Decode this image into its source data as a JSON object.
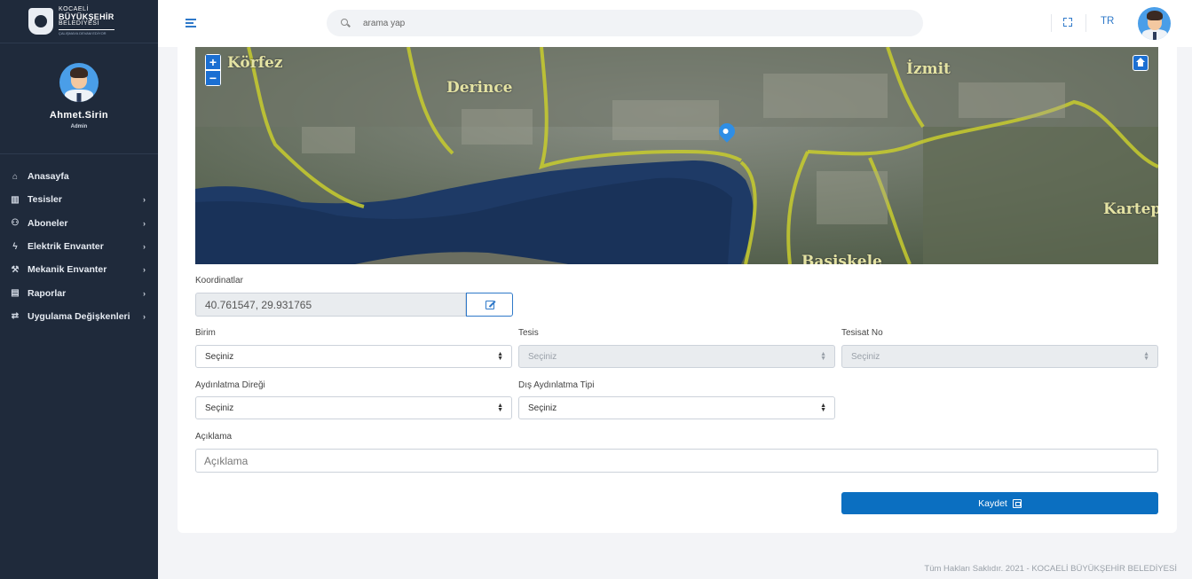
{
  "sidebar": {
    "logo": {
      "line1": "KOCAELİ",
      "line2": "BÜYÜKŞEHİR",
      "line3": "BELEDİYESİ",
      "line4": "ÇALIŞMAYA DEVAM EDİYOR"
    },
    "user": {
      "name": "Ahmet.Sirin",
      "role": "Admin"
    },
    "items": [
      {
        "label": "Anasayfa",
        "icon": "home-icon",
        "has_submenu": false
      },
      {
        "label": "Tesisler",
        "icon": "building-icon",
        "has_submenu": true
      },
      {
        "label": "Aboneler",
        "icon": "users-icon",
        "has_submenu": true
      },
      {
        "label": "Elektrik Envanter",
        "icon": "lightning-icon",
        "has_submenu": true
      },
      {
        "label": "Mekanik Envanter",
        "icon": "wrench-icon",
        "has_submenu": true
      },
      {
        "label": "Raporlar",
        "icon": "report-icon",
        "has_submenu": true
      },
      {
        "label": "Uygulama Değişkenleri",
        "icon": "sync-icon",
        "has_submenu": true
      }
    ]
  },
  "header": {
    "search_placeholder": "arama yap",
    "language": "TR"
  },
  "map": {
    "labels": [
      "Körfez",
      "Derince",
      "İzmit",
      "Kartepe",
      "Başiskele"
    ],
    "zoom_in": "+",
    "zoom_out": "−"
  },
  "form": {
    "coordinates_label": "Koordinatlar",
    "coordinates_value": "40.761547, 29.931765",
    "birim": {
      "label": "Birim",
      "value": "Seçiniz"
    },
    "tesis": {
      "label": "Tesis",
      "value": "Seçiniz"
    },
    "tesisat_no": {
      "label": "Tesisat No",
      "value": "Seçiniz"
    },
    "aydinlatma_diregi": {
      "label": "Aydınlatma Direği",
      "value": "Seçiniz"
    },
    "dis_aydinlatma_tipi": {
      "label": "Dış Aydınlatma Tipi",
      "value": "Seçiniz"
    },
    "aciklama": {
      "label": "Açıklama",
      "placeholder": "Açıklama"
    },
    "save_label": "Kaydet"
  },
  "footer": {
    "text": "Tüm Hakları Saklıdır. 2021 - KOCAELİ BÜYÜKŞEHİR BELEDİYESİ"
  },
  "colors": {
    "sidebar_bg": "#1f2a3b",
    "accent": "#2f79c9",
    "button": "#0b6fc1"
  }
}
